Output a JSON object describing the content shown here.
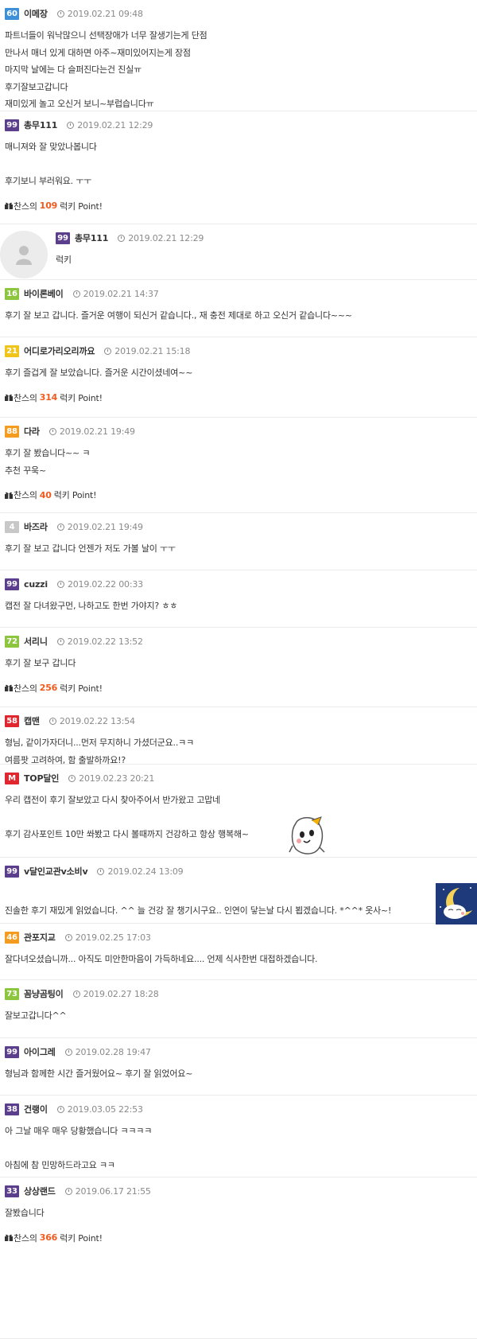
{
  "point_template": {
    "prefix": "찬스의",
    "suffix": "럭키 Point!"
  },
  "comments": [
    {
      "level": "60",
      "level_color": "#3d8fd8",
      "nick": "이메장",
      "time": "2019.02.21 09:48",
      "lines": [
        "파트너들이 워낙많으니 선택장애가 너무 잘생기는게 단점",
        "만나서 매너 있게 대하면 아주~재미있어지는게 장점",
        "마지막 날에는 다 슬퍼진다는건 진실ㅠ",
        "후기잘보고갑니다",
        "재미있게 놀고 오신거 보니~부럽습니다ㅠ"
      ]
    },
    {
      "level": "99",
      "level_color": "#5c3f8c",
      "nick": "총무111",
      "time": "2019.02.21 12:29",
      "lines": [
        "매니져와 잘 맞았나봅니다",
        "",
        "후기보니 부러워요. ㅜㅜ"
      ],
      "point": "109"
    },
    {
      "level": "99",
      "level_color": "#5c3f8c",
      "nick": "총무111",
      "time": "2019.02.21 12:29",
      "lines": [
        "럭키"
      ],
      "reply": true
    },
    {
      "level": "16",
      "level_color": "#8cc63e",
      "nick": "바이론베이",
      "time": "2019.02.21 14:37",
      "lines": [
        "후기 잘 보고 갑니다. 즐거운 여행이 되신거 같습니다., 재 충전 제대로 하고 오신거 같습니다~~~"
      ]
    },
    {
      "level": "21",
      "level_color": "#f0c419",
      "nick": "어디로가리오리까요",
      "time": "2019.02.21 15:18",
      "lines": [
        "후기 즐겁게 잘 보았습니다. 즐거운 시간이셨네여~~"
      ],
      "point": "314"
    },
    {
      "level": "88",
      "level_color": "#f39c1f",
      "nick": "다라",
      "time": "2019.02.21 19:49",
      "lines": [
        "후기 잘 봤습니다~~ ㅋ",
        "추천 꾸욱~"
      ],
      "point": "40"
    },
    {
      "level": "4",
      "level_color": "#c8c8c8",
      "nick": "바즈라",
      "time": "2019.02.21 19:49",
      "lines": [
        "후기 잘 보고 갑니다   언젠가 저도 가볼 날이 ㅜㅜ"
      ]
    },
    {
      "level": "99",
      "level_color": "#5c3f8c",
      "nick": "cuzzi",
      "time": "2019.02.22 00:33",
      "lines": [
        "캡전 잘 다녀왔구먼, 나하고도 한번 가야지? ㅎㅎ"
      ]
    },
    {
      "level": "72",
      "level_color": "#8cc63e",
      "nick": "서리니",
      "time": "2019.02.22 13:52",
      "lines": [
        "후기 잘 보구 갑니다"
      ],
      "point": "256"
    },
    {
      "level": "58",
      "level_color": "#e0262e",
      "nick": "캡맨",
      "time": "2019.02.22 13:54",
      "lines": [
        "형님, 같이가자더니...먼저 무지하니 가셨더군요..ㅋㅋ",
        "여름팟 고려하여, 함 출발하까요!?"
      ]
    },
    {
      "level": "M",
      "level_color": "#e0262e",
      "nick": "TOP달인",
      "time": "2019.02.23 20:21",
      "lines": [
        "우리 캡전이 후기 잘보았고 다시 찾아주어서 반가왔고 고맙네",
        "",
        "후기 감사포인트 10만 쏴봤고 다시 볼때까지 건강하고 항상 행복해~"
      ],
      "emoticon": "ghost"
    },
    {
      "level": "99",
      "level_color": "#5c3f8c",
      "nick": "v달인교관v소비v",
      "time": "2019.02.24 13:09",
      "lines": [
        "",
        "진솔한 후기 재밌게 읽었습니다. ^^ 늘 건강 잘 챙기시구요.. 인연이 닿는날 다시 뵙겠습니다. *^^* 옷사~!"
      ],
      "emoticon": "moon"
    },
    {
      "level": "46",
      "level_color": "#f39c1f",
      "nick": "관포지교",
      "time": "2019.02.25 17:03",
      "lines": [
        "잘다녀오셨습니까... 아직도 미안한마음이 가득하네요.... 언제 식사한번 대접하겠습니다."
      ]
    },
    {
      "level": "73",
      "level_color": "#8cc63e",
      "nick": "꼼냥곰팅이",
      "time": "2019.02.27 18:28",
      "lines": [
        "잘보고갑니다^^"
      ]
    },
    {
      "level": "99",
      "level_color": "#5c3f8c",
      "nick": "아이그레",
      "time": "2019.02.28 19:47",
      "lines": [
        "형님과 함께한 시간 즐거웠어요~ 후기 잘 읽었어요~"
      ]
    },
    {
      "level": "38",
      "level_color": "#5c3f8c",
      "nick": "건랭이",
      "time": "2019.03.05 22:53",
      "lines": [
        "아 그날 매우 매우 당황했습니다 ㅋㅋㅋㅋ",
        "",
        "아침에 참 민망하드라고요 ㅋㅋ"
      ]
    },
    {
      "level": "33",
      "level_color": "#5c3f8c",
      "nick": "상상랜드",
      "time": "2019.06.17 21:55",
      "lines": [
        "잘봤습니다"
      ],
      "point": "366"
    }
  ]
}
